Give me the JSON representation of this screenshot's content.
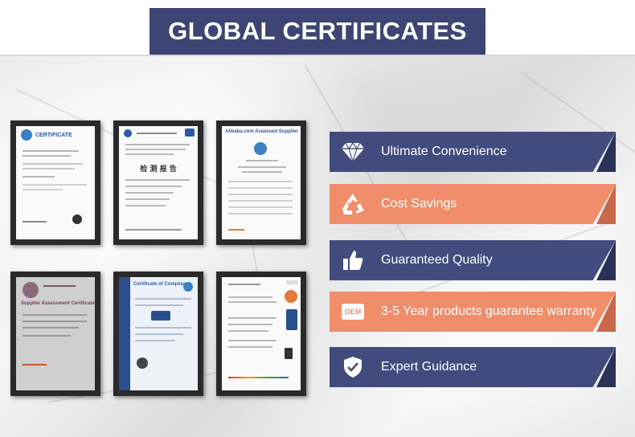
{
  "header": {
    "title": "GLOBAL CERTIFICATES"
  },
  "certificates": [
    {
      "head": "CERTIFICATE"
    },
    {
      "head": "",
      "cn_title": "检 测 报 告"
    },
    {
      "head": "Alibaba.com Assessed Supplier"
    },
    {
      "head": "Supplier Assessment Certificate"
    },
    {
      "head": "Certificate of Compliance"
    },
    {
      "head": "SGS"
    }
  ],
  "features": [
    {
      "label": "Ultimate Convenience",
      "icon": "diamond-icon",
      "style": "navy"
    },
    {
      "label": "Cost Savings",
      "icon": "recycle-icon",
      "style": "orange"
    },
    {
      "label": "Guaranteed Quality",
      "icon": "thumbs-up-icon",
      "style": "navy"
    },
    {
      "label": "3-5 Year products guarantee warranty",
      "icon": "oem-icon",
      "style": "orange"
    },
    {
      "label": "Expert Guidance",
      "icon": "shield-check-icon",
      "style": "navy"
    }
  ],
  "icon_text": {
    "oem": "OEM"
  },
  "colors": {
    "navy": "#414b7e",
    "orange": "#f08d6a",
    "title_bg": "#3c4574"
  }
}
